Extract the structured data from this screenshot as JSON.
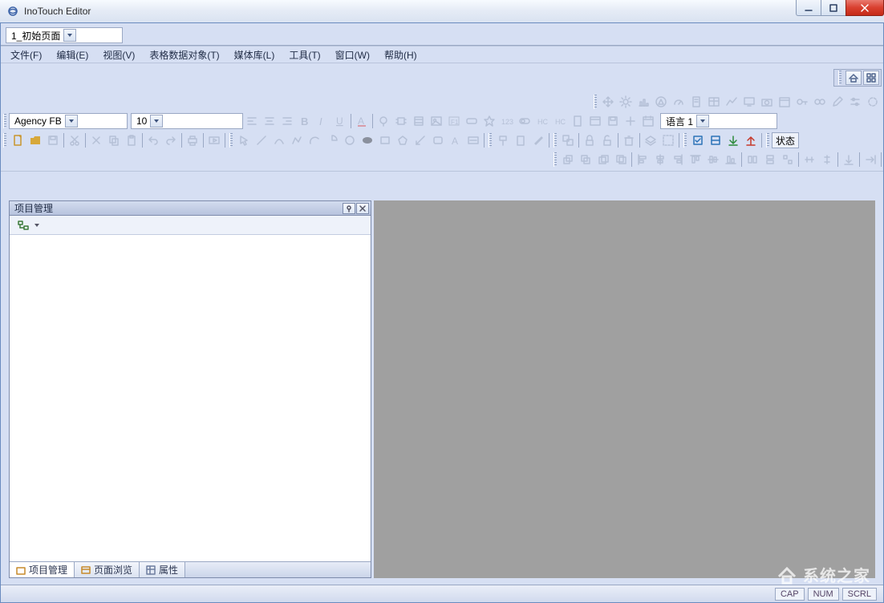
{
  "window": {
    "title": "InoTouch Editor"
  },
  "page_combo": {
    "value": "1_初始页面"
  },
  "menu": [
    "文件(F)",
    "编辑(E)",
    "视图(V)",
    "表格数据对象(T)",
    "媒体库(L)",
    "工具(T)",
    "窗口(W)",
    "帮助(H)"
  ],
  "font_row": {
    "font": "Agency FB",
    "size": "10"
  },
  "language": {
    "label": "语言 1"
  },
  "status_button": "状态",
  "panel": {
    "title": "项目管理"
  },
  "bottom_tabs": [
    "项目管理",
    "页面浏览",
    "属性"
  ],
  "statusbar": {
    "cap": "CAP",
    "num": "NUM",
    "scrl": "SCRL"
  },
  "watermark": "系统之家"
}
